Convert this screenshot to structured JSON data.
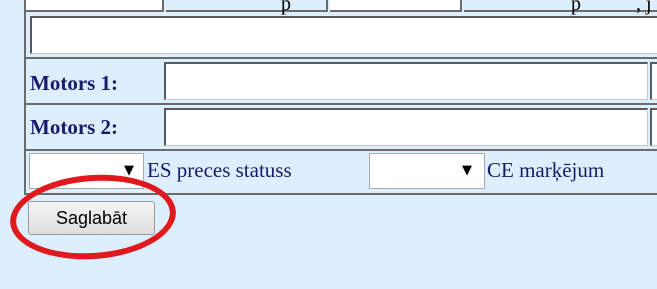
{
  "top_row": {
    "fragment_a": "p",
    "fragment_b": "p",
    "fragment_c": ", j"
  },
  "fields": {
    "motor1_label": "Motors 1:",
    "motor2_label": "Motors 2:"
  },
  "status_row": {
    "es_label": "ES preces statuss",
    "ce_label": "CE marķējum"
  },
  "actions": {
    "save_label": "Saglabāt"
  },
  "annotation": {
    "color": "#e0191e",
    "shape": "ellipse"
  }
}
